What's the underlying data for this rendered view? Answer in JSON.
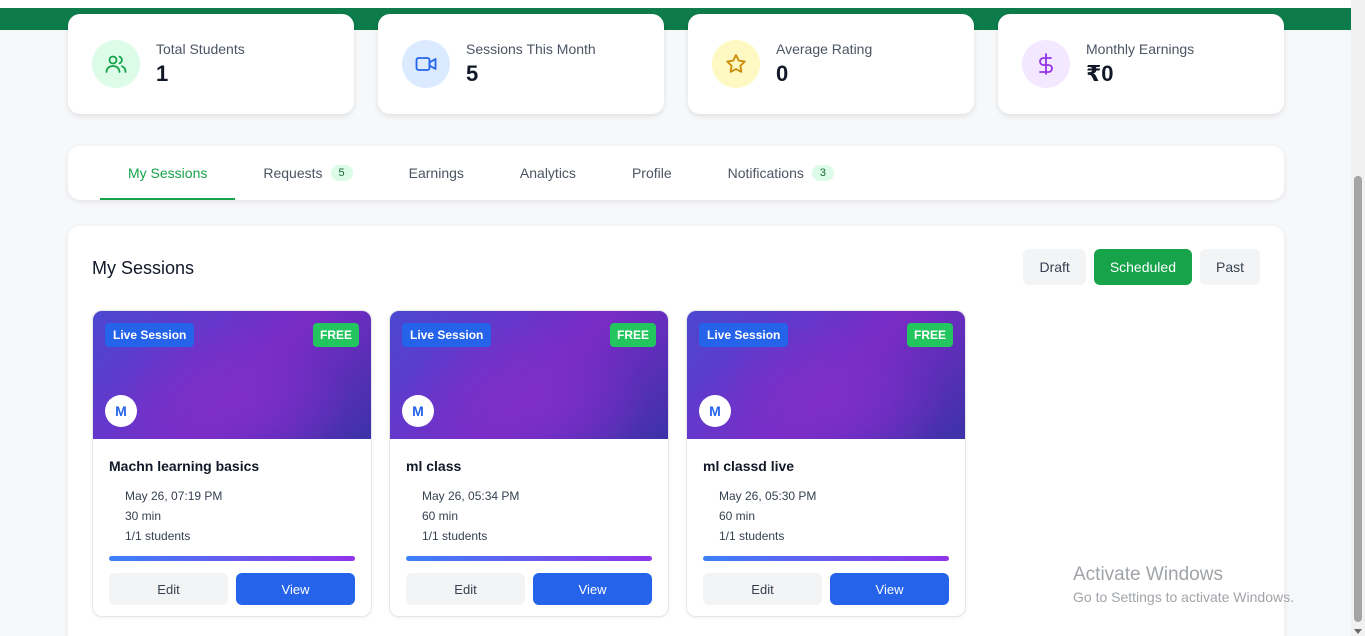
{
  "stats": [
    {
      "label": "Total Students",
      "value": "1",
      "icon": "users-icon",
      "bg": "#dcfce7",
      "color": "#16a34a"
    },
    {
      "label": "Sessions This Month",
      "value": "5",
      "icon": "video-icon",
      "bg": "#dbeafe",
      "color": "#2563eb"
    },
    {
      "label": "Average Rating",
      "value": "0",
      "icon": "star-icon",
      "bg": "#fef9c3",
      "color": "#ca8a04"
    },
    {
      "label": "Monthly Earnings",
      "value": "₹0",
      "icon": "dollar-icon",
      "bg": "#f3e8ff",
      "color": "#9333ea"
    }
  ],
  "tabs": [
    {
      "label": "My Sessions",
      "active": true
    },
    {
      "label": "Requests",
      "badge": "5"
    },
    {
      "label": "Earnings"
    },
    {
      "label": "Analytics"
    },
    {
      "label": "Profile"
    },
    {
      "label": "Notifications",
      "badge": "3"
    }
  ],
  "panel": {
    "title": "My Sessions",
    "filters": [
      {
        "label": "Draft"
      },
      {
        "label": "Scheduled",
        "active": true
      },
      {
        "label": "Past"
      }
    ]
  },
  "sessions": [
    {
      "tag": "Live Session",
      "price": "FREE",
      "avatar": "M",
      "title": "Machn learning basics",
      "date": "May 26, 07:19 PM",
      "duration": "30 min",
      "students": "1/1 students",
      "fill": 1.0,
      "edit": "Edit",
      "view": "View"
    },
    {
      "tag": "Live Session",
      "price": "FREE",
      "avatar": "M",
      "title": "ml class",
      "date": "May 26, 05:34 PM",
      "duration": "60 min",
      "students": "1/1 students",
      "fill": 1.0,
      "edit": "Edit",
      "view": "View"
    },
    {
      "tag": "Live Session",
      "price": "FREE",
      "avatar": "M",
      "title": "ml classd live",
      "date": "May 26, 05:30 PM",
      "duration": "60 min",
      "students": "1/1 students",
      "fill": 1.0,
      "edit": "Edit",
      "view": "View"
    }
  ],
  "watermark": {
    "line1": "Activate Windows",
    "line2": "Go to Settings to activate Windows."
  }
}
